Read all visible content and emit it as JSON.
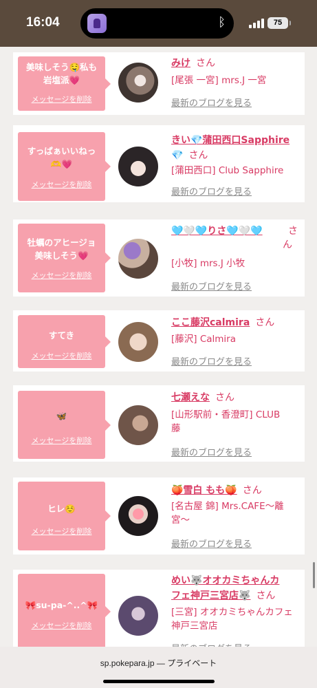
{
  "status": {
    "time": "16:04",
    "battery": "75"
  },
  "cards": [
    {
      "message_lines": [
        "美味しそう🤤私も",
        "岩塩派💗"
      ],
      "delete_label": "メッセージを削除",
      "name": "みけ",
      "san": "さん",
      "location_lines": [
        "[尾張 一宮] mrs.J 一宮"
      ],
      "blog": "最新のブログを見る"
    },
    {
      "message_lines": [
        "すっぱぁいいねっ",
        "🫶💗"
      ],
      "delete_label": "メッセージを削除",
      "name": "きい💎蒲田西口Sapphire",
      "name2": "💎",
      "san": "さん",
      "location_lines": [
        "[蒲田西口] Club Sapphire"
      ],
      "blog": "最新のブログを見る"
    },
    {
      "message_lines": [
        "牡蠣のアヒージョ",
        "美味しそう💗"
      ],
      "delete_label": "メッセージを削除",
      "name": "🩵🤍🩵りさ🩵🤍🩵",
      "san": "さん",
      "location_lines": [
        "[小牧] mrs.J 小牧"
      ],
      "blog": "最新のブログを見る"
    },
    {
      "message_lines": [
        "すてき"
      ],
      "delete_label": "メッセージを削除",
      "name": "ここ藤沢calmira",
      "san": "さん",
      "location_lines": [
        "[藤沢] Calmira"
      ],
      "blog": "最新のブログを見る"
    },
    {
      "message_lines": [
        "🦋"
      ],
      "delete_label": "メッセージを削除",
      "name": "七瀬えな",
      "san": "さん",
      "location_lines": [
        "[山形駅前・香澄町] CLUB",
        "藤"
      ],
      "blog": "最新のブログを見る"
    },
    {
      "message_lines": [
        "ヒレ☺️"
      ],
      "delete_label": "メッセージを削除",
      "name": "🍑雪白 もも🍑",
      "san": "さん",
      "location_lines": [
        "[名古屋 錦] Mrs.CAFE〜離",
        "宮〜"
      ],
      "blog": "最新のブログを見る"
    },
    {
      "message_lines": [
        "🎀su-pa-^..^🎀"
      ],
      "delete_label": "メッセージを削除",
      "name": "めい🐺オオカミちゃんカ",
      "name2": "フェ神戸三宮店🐺",
      "san": "さん",
      "location_lines": [
        "[三宮] オオカミちゃんカフェ",
        "神戸三宮店"
      ],
      "blog": "最新のブログを見る"
    }
  ],
  "urlbar": {
    "domain": "sp.pokepara.jp",
    "label": "— プライベート"
  }
}
